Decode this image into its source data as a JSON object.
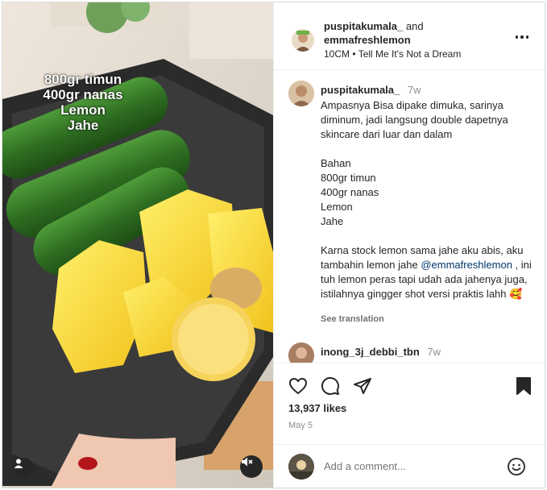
{
  "media": {
    "overlay_lines": [
      "800gr timun",
      "400gr nanas",
      "Lemon",
      "Jahe"
    ],
    "user_tag_icon": "person-icon",
    "mute_icon": "speaker-muted-icon"
  },
  "header": {
    "user1": "puspitakumala_",
    "and_text": "and",
    "user2": "emmafreshlemon",
    "audio_artist": "10CM",
    "audio_separator": "•",
    "audio_title": "Tell Me It's Not a Dream",
    "more_icon": "more-horizontal-icon"
  },
  "caption_comment": {
    "username": "puspitakumala_",
    "time": "7w",
    "text_before_mention": "Ampasnya Bisa dipake dimuka, sarinya diminum, jadi langsung double dapetnya skincare dari luar dan dalam\n\nBahan\n800gr timun\n400gr nanas\nLemon\nJahe\n\nKarna stock lemon sama jahe aku abis, aku tambahin lemon jahe ",
    "mention": "@emmafreshlemon",
    "text_after_mention": " , ini tuh lemon peras tapi udah ada jahenya juga, istilahnya gingger shot versi praktis lahh 🥰",
    "see_translation": "See translation"
  },
  "comment2": {
    "username": "inong_3j_debbi_tbn",
    "time": "7w"
  },
  "actions": {
    "like_icon": "heart-icon",
    "comment_icon": "comment-icon",
    "share_icon": "share-icon",
    "save_icon": "bookmark-icon",
    "likes": "13,937 likes",
    "date": "May 5"
  },
  "add_comment": {
    "placeholder": "Add a comment...",
    "emoji_icon": "emoji-icon"
  },
  "colors": {
    "text": "#262626",
    "secondary": "#8e8e8e",
    "mention": "#00376b",
    "border": "#dbdbdb"
  }
}
